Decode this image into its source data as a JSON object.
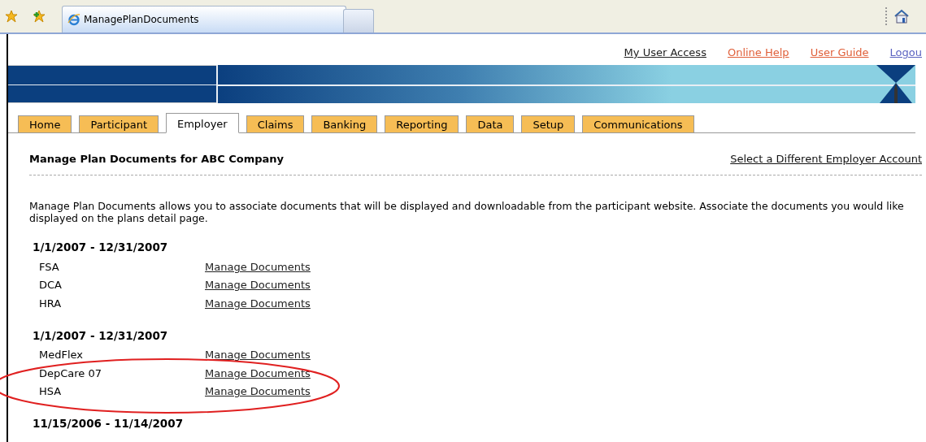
{
  "browser": {
    "tab_title": "ManagePlanDocuments"
  },
  "top_links": [
    {
      "label": "My User Access",
      "kind": "dark"
    },
    {
      "label": "Online Help",
      "kind": "orange"
    },
    {
      "label": "User Guide",
      "kind": "orange"
    },
    {
      "label": "Logou",
      "kind": "blue"
    }
  ],
  "tabs": [
    {
      "label": "Home",
      "selected": false
    },
    {
      "label": "Participant",
      "selected": false
    },
    {
      "label": "Employer",
      "selected": true
    },
    {
      "label": "Claims",
      "selected": false
    },
    {
      "label": "Banking",
      "selected": false
    },
    {
      "label": "Reporting",
      "selected": false
    },
    {
      "label": "Data",
      "selected": false
    },
    {
      "label": "Setup",
      "selected": false
    },
    {
      "label": "Communications",
      "selected": false
    }
  ],
  "heading": "Manage Plan Documents for ABC Company",
  "switch_link": "Select a Different Employer Account",
  "description": "Manage Plan Documents allows you to associate documents that will be displayed and downloadable from the participant website. Associate the documents you would like displayed on the plans detail page.",
  "groups": [
    {
      "period": "1/1/2007 - 12/31/2007",
      "plans": [
        {
          "name": "FSA",
          "link": "Manage Documents"
        },
        {
          "name": "DCA",
          "link": "Manage Documents"
        },
        {
          "name": "HRA",
          "link": "Manage Documents"
        }
      ]
    },
    {
      "period": "1/1/2007 - 12/31/2007",
      "plans": [
        {
          "name": "MedFlex",
          "link": "Manage Documents"
        },
        {
          "name": "DepCare 07",
          "link": "Manage Documents"
        },
        {
          "name": "HSA",
          "link": "Manage Documents"
        }
      ]
    },
    {
      "period": "11/15/2006 - 11/14/2007"
    }
  ]
}
